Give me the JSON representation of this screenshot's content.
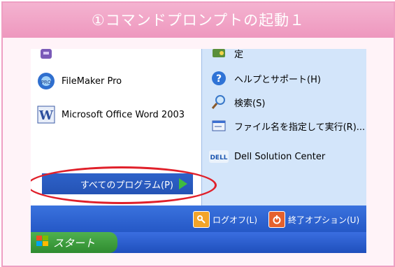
{
  "title": "①コマンドプロンプトの起動１",
  "left_items": [
    {
      "label": "",
      "icon": "program-icon"
    },
    {
      "label": "FileMaker Pro",
      "icon": "filemaker-icon"
    },
    {
      "label": "Microsoft Office Word 2003",
      "icon": "word-icon"
    }
  ],
  "all_programs": {
    "label": "すべてのプログラム(P)",
    "icon": "green-arrow-icon"
  },
  "right_items": [
    {
      "label": "定",
      "icon": "settings-icon"
    },
    {
      "label": "ヘルプとサポート(H)",
      "icon": "help-icon"
    },
    {
      "label": "検索(S)",
      "icon": "search-icon"
    },
    {
      "label": "ファイル名を指定して実行(R)...",
      "icon": "run-icon"
    },
    {
      "label": "Dell Solution Center",
      "icon": "dell-icon"
    }
  ],
  "logoff": {
    "label": "ログオフ(L)",
    "icon": "key-icon",
    "color": "#f2a42a"
  },
  "shutdown": {
    "label": "終了オプション(U)",
    "icon": "power-icon",
    "color": "#e5612d"
  },
  "start": {
    "label": "スタート",
    "icon": "windows-flag-icon"
  }
}
